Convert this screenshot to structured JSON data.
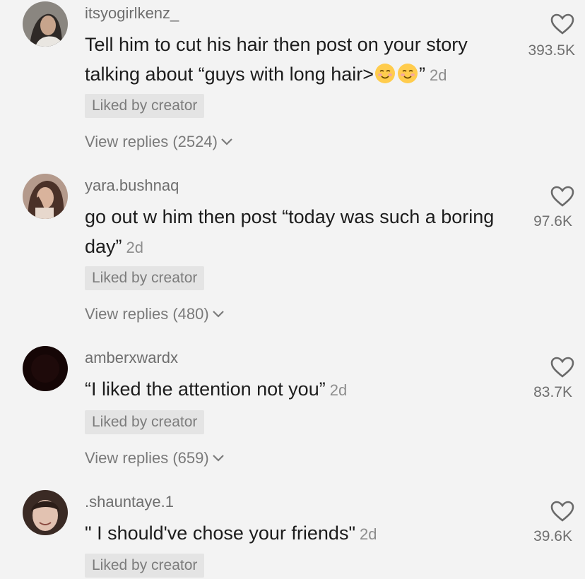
{
  "comments": [
    {
      "username": "itsyogirlkenz_",
      "text_before": "Tell him to cut his hair then post on your story talking about “guys with long hair>",
      "text_after": "”",
      "emoji_icon": "smiling-relieved-face-emoji",
      "time": "2d",
      "badge": "Liked by creator",
      "replies": "View replies (2524)",
      "likes": "393.5K"
    },
    {
      "username": "yara.bushnaq",
      "text": "go out w him then post “today was such a boring day”",
      "time": "2d",
      "badge": "Liked by creator",
      "replies": "View replies (480)",
      "likes": "97.6K"
    },
    {
      "username": "amberxwardx",
      "text": "“I liked the attention not you”",
      "time": "2d",
      "badge": "Liked by creator",
      "replies": "View replies (659)",
      "likes": "83.7K"
    },
    {
      "username": ".shauntaye.1",
      "text": "\" I should've chose your friends\"",
      "time": "2d",
      "badge": "Liked by creator",
      "likes": "39.6K"
    }
  ],
  "icons": {
    "like": "heart-outline-icon",
    "expand": "chevron-down-icon"
  }
}
